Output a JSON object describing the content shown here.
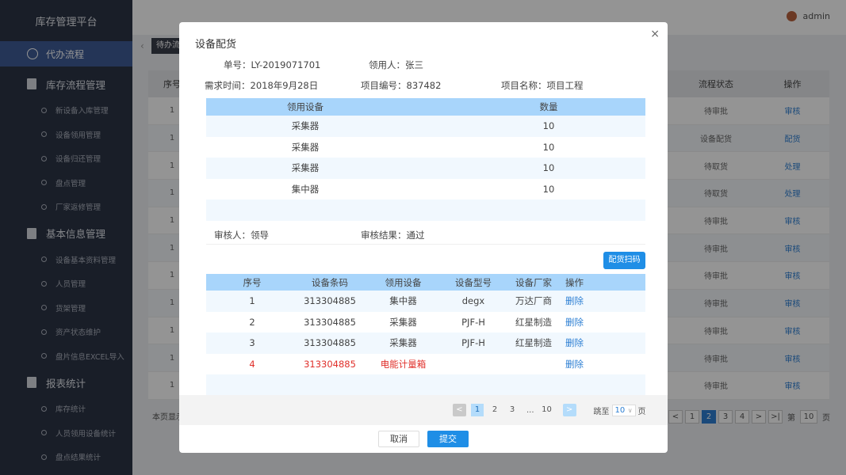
{
  "app": {
    "title": "库存管理平台",
    "user": "admin"
  },
  "sidebar": {
    "active": "代办流程",
    "groups": [
      {
        "label": "库存流程管理",
        "items": [
          "新设备入库管理",
          "设备领用管理",
          "设备归还管理",
          "盘点管理",
          "厂家返修管理"
        ]
      },
      {
        "label": "基本信息管理",
        "items": [
          "设备基本资料管理",
          "人员管理",
          "货架管理",
          "资产状态维护",
          "盘片信息EXCEL导入"
        ]
      },
      {
        "label": "报表统计",
        "items": [
          "库存统计",
          "人员领用设备统计",
          "盘点结果统计"
        ]
      }
    ]
  },
  "background": {
    "tab": "待办流",
    "table": {
      "col_idx": "序号",
      "col_status": "流程状态",
      "col_op": "操作",
      "rows": [
        {
          "idx": "1",
          "status": "待审批",
          "op": "审核"
        },
        {
          "idx": "1",
          "status": "设备配货",
          "op": "配货"
        },
        {
          "idx": "1",
          "status": "待取货",
          "op": "处理"
        },
        {
          "idx": "1",
          "status": "待取货",
          "op": "处理"
        },
        {
          "idx": "1",
          "status": "待审批",
          "op": "审核"
        },
        {
          "idx": "1",
          "status": "待审批",
          "op": "审核"
        },
        {
          "idx": "1",
          "status": "待审批",
          "op": "审核"
        },
        {
          "idx": "1",
          "status": "待审批",
          "op": "审核"
        },
        {
          "idx": "1",
          "status": "待审批",
          "op": "审核"
        },
        {
          "idx": "1",
          "status": "待审批",
          "op": "审核"
        },
        {
          "idx": "1",
          "status": "待审批",
          "op": "审核"
        }
      ]
    },
    "footer_text": "本页显示",
    "pager": {
      "pages": [
        "1",
        "2",
        "3",
        "4"
      ],
      "active": "2",
      "prev": "<",
      "next": ">",
      "last": ">|",
      "label_di": "第",
      "page_value": "10",
      "label_ye": "页"
    }
  },
  "modal": {
    "title": "设备配货",
    "close": "×",
    "order_no": "单号：LY-2019071701",
    "requester": "领用人：张三",
    "need_time": "需求时间：2018年9月28日",
    "project_no": "项目编号：837482",
    "project_name": "项目名称：项目工程",
    "table1": {
      "headers": [
        "领用设备",
        "数量"
      ],
      "rows": [
        [
          "采集器",
          "10"
        ],
        [
          "采集器",
          "10"
        ],
        [
          "采集器",
          "10"
        ],
        [
          "集中器",
          "10"
        ]
      ]
    },
    "auditor": "审核人：领导",
    "audit_result": "审核结果：通过",
    "scan_button": "配货扫码",
    "table2": {
      "headers": [
        "序号",
        "设备条码",
        "领用设备",
        "设备型号",
        "设备厂家",
        "操作"
      ],
      "rows": [
        [
          "1",
          "313304885",
          "集中器",
          "degx",
          "万达厂商",
          "删除"
        ],
        [
          "2",
          "313304885",
          "采集器",
          "PJF-H",
          "红星制造",
          "删除"
        ],
        [
          "3",
          "313304885",
          "采集器",
          "PJF-H",
          "红星制造",
          "删除"
        ],
        [
          "4",
          "313304885",
          "电能计量箱",
          "",
          "",
          "删除"
        ]
      ]
    },
    "pager": {
      "prev": "<",
      "next": ">",
      "pages": [
        "1",
        "2",
        "3",
        "...",
        "10"
      ],
      "active": "1",
      "jump_label": "跳至",
      "jump_value": "10",
      "page_label": "页"
    },
    "cancel": "取消",
    "submit": "提交"
  },
  "colors": {
    "accent": "#1f8ee6",
    "table_header": "#a8d5fb",
    "error_row": "#e0302b",
    "sidebar": "#2b3445"
  }
}
